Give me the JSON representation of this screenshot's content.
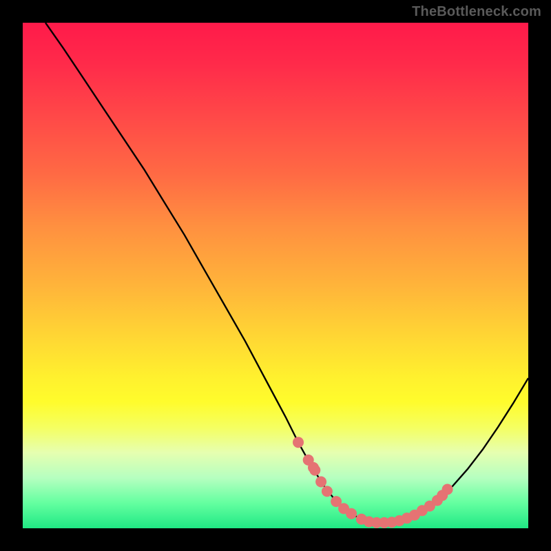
{
  "watermark": "TheBottleneck.com",
  "chart_data": {
    "type": "line",
    "title": "",
    "xlabel": "",
    "ylabel": "",
    "xlim": [
      0,
      100
    ],
    "ylim": [
      0,
      100
    ],
    "grid": false,
    "legend": false,
    "series": [
      {
        "name": "bottleneck-curve",
        "x_pct": [
          4.5,
          8,
          12,
          16,
          20,
          24,
          28,
          32,
          36,
          40,
          44,
          48,
          52,
          54.5,
          57,
          59.5,
          62,
          64.5,
          67,
          70,
          73,
          76,
          79,
          82,
          85,
          88,
          91,
          94,
          97,
          100
        ],
        "y_pct": [
          100,
          95,
          89,
          83,
          77,
          71,
          64.5,
          58,
          51,
          44,
          37,
          29.5,
          22,
          17,
          12.5,
          8.5,
          5.3,
          3.1,
          1.8,
          1.1,
          1.2,
          2.0,
          3.5,
          5.5,
          8.3,
          11.7,
          15.6,
          20,
          24.7,
          29.7
        ]
      }
    ],
    "markers": {
      "name": "highlight-dots",
      "x_pct": [
        54.5,
        56.5,
        57.5,
        57.8,
        59,
        60.2,
        62,
        63.5,
        65,
        67,
        68.5,
        70,
        71.5,
        73,
        74.5,
        76,
        77.5,
        79,
        80.5,
        82,
        83,
        84
      ],
      "y_pct": [
        17,
        13.5,
        12,
        11.5,
        9.2,
        7.3,
        5.3,
        3.9,
        2.9,
        1.8,
        1.3,
        1.1,
        1.1,
        1.2,
        1.5,
        2.0,
        2.6,
        3.5,
        4.4,
        5.5,
        6.5,
        7.7
      ]
    },
    "background_gradient": {
      "top": "#ff1a4a",
      "mid": "#fff02e",
      "bottom": "#20e884"
    }
  }
}
